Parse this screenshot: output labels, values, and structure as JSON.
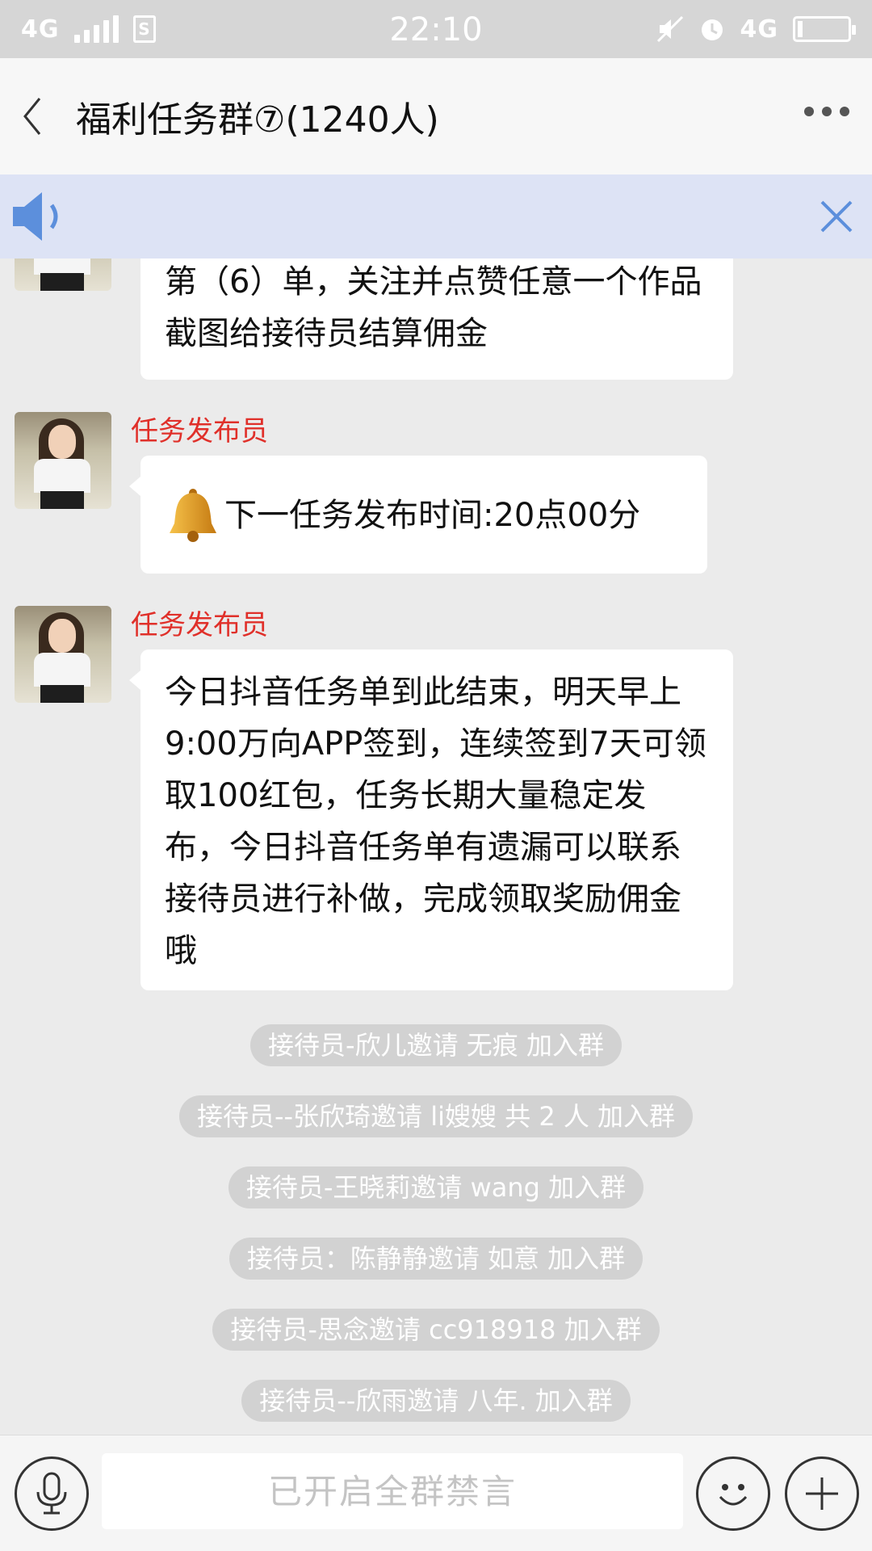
{
  "status_bar": {
    "network_left": "4G",
    "sim_label": "S",
    "time": "22:10",
    "network_right": "4G"
  },
  "header": {
    "title": "福利任务群⑦(1240人)"
  },
  "messages": [
    {
      "text": "第（6）单，关注并点赞任意一个作品截图给接待员结算佣金"
    },
    {
      "sender": "任务发布员",
      "text": "下一任务发布时间:20点00分"
    },
    {
      "sender": "任务发布员",
      "text": "今日抖音任务单到此结束，明天早上9:00万向APP签到，连续签到7天可领取100红包，任务长期大量稳定发布，今日抖音任务单有遗漏可以联系接待员进行补做，完成领取奖励佣金哦"
    }
  ],
  "system_notices": [
    "接待员-欣儿邀请 无痕 加入群",
    "接待员--张欣琦邀请 li嫂嫂 共 2 人 加入群",
    "接待员-王晓莉邀请 wang 加入群",
    "接待员：陈静静邀请 如意 加入群",
    "接待员-思念邀请 cc918918 加入群",
    "接待员--欣雨邀请 八年. 加入群"
  ],
  "input": {
    "placeholder": "已开启全群禁言"
  },
  "colors": {
    "sender_name": "#e0302a",
    "notice_bar": "#dde3f5",
    "accent_icon": "#4a90e2"
  },
  "icons": [
    "back-icon",
    "more-icon",
    "speaker-icon",
    "close-icon",
    "bell-icon",
    "microphone-icon",
    "emoji-icon",
    "plus-icon"
  ]
}
